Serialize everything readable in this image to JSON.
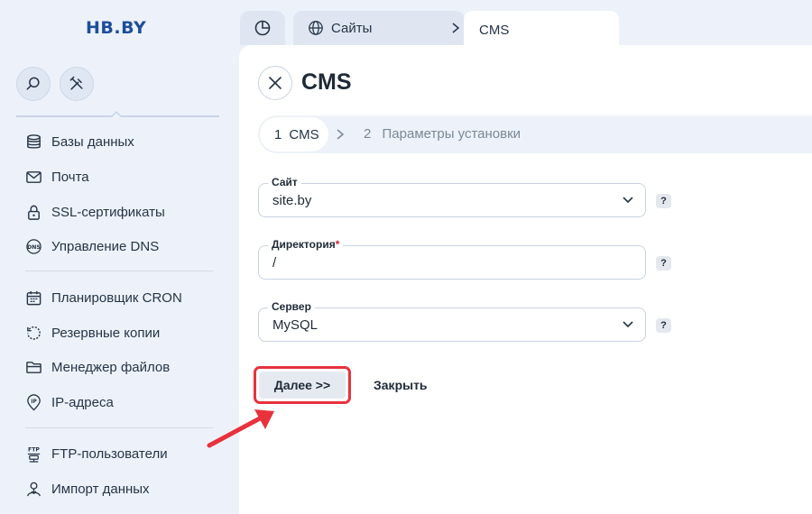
{
  "brand": {
    "logo": "HB.BY"
  },
  "sidebar": {
    "tool_buttons": [
      {
        "name": "search",
        "icon": "search-icon"
      },
      {
        "name": "tools",
        "icon": "tools-icon"
      }
    ],
    "groups": [
      [
        {
          "label": "Базы данных",
          "icon": "database-icon"
        },
        {
          "label": "Почта",
          "icon": "mail-icon"
        },
        {
          "label": "SSL-сертификаты",
          "icon": "lock-icon"
        },
        {
          "label": "Управление DNS",
          "icon": "dns-icon"
        }
      ],
      [
        {
          "label": "Планировщик CRON",
          "icon": "calendar-icon"
        },
        {
          "label": "Резервные копии",
          "icon": "backup-icon"
        },
        {
          "label": "Менеджер файлов",
          "icon": "folder-icon"
        },
        {
          "label": "IP-адреса",
          "icon": "ip-icon"
        }
      ],
      [
        {
          "label": "FTP-пользователи",
          "icon": "ftp-icon"
        },
        {
          "label": "Импорт данных",
          "icon": "import-icon"
        }
      ]
    ]
  },
  "tabs": {
    "dashboard_icon": "pie-chart-icon",
    "sites": {
      "label": "Сайты",
      "icon": "globe-icon"
    },
    "active": {
      "label": "CMS"
    }
  },
  "page": {
    "title": "CMS"
  },
  "wizard": {
    "steps": [
      {
        "number": "1",
        "label": "CMS",
        "active": true
      },
      {
        "number": "2",
        "label": "Параметры установки",
        "active": false
      }
    ]
  },
  "form": {
    "site": {
      "label": "Сайт",
      "value": "site.by",
      "help": "?"
    },
    "directory": {
      "label": "Директория",
      "required_mark": "*",
      "value": "/",
      "help": "?"
    },
    "server": {
      "label": "Сервер",
      "value": "MySQL",
      "help": "?"
    }
  },
  "actions": {
    "next_label": "Далее >>",
    "close_label": "Закрыть"
  },
  "colors": {
    "brand": "#1d4e9b",
    "highlight": "#e8323c",
    "background": "#edf2fa",
    "panel": "#ffffff"
  }
}
